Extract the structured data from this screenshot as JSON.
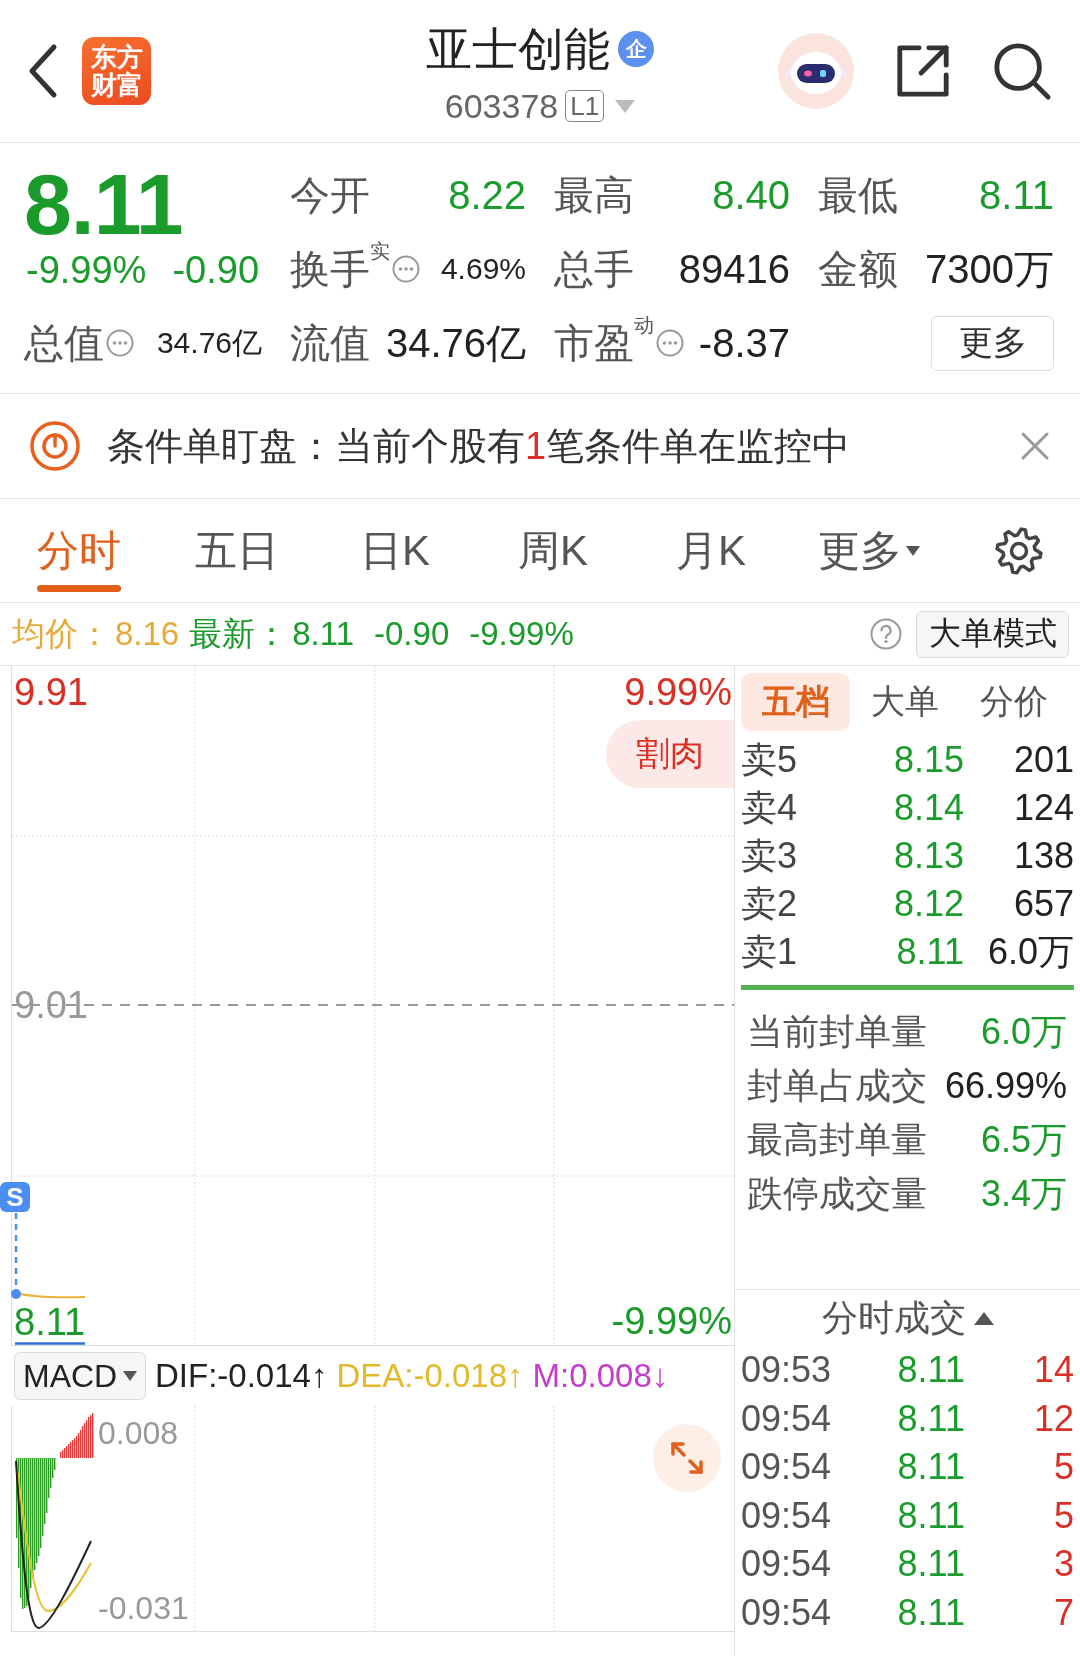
{
  "header": {
    "logo": "东方财富",
    "title": "亚士创能",
    "badge": "企",
    "code": "603378",
    "level_tag": "L1"
  },
  "quote": {
    "price": "8.11",
    "change_pct": "-9.99%",
    "change": "-0.90",
    "stats": [
      {
        "label": "今开",
        "value": "8.22",
        "color": "#1a9b2b",
        "info": false,
        "kind": "standard"
      },
      {
        "label": "最高",
        "value": "8.40",
        "color": "#1a9b2b",
        "info": false,
        "kind": "standard"
      },
      {
        "label": "最低",
        "value": "8.11",
        "color": "#1a9b2b",
        "info": false,
        "kind": "standard"
      },
      {
        "label": "换手$^{实}$",
        "value": "4.69%",
        "color": "#222222",
        "info": true,
        "kind": "compact"
      },
      {
        "label": "总手",
        "value": "89416",
        "color": "#222222",
        "info": false,
        "kind": "standard"
      },
      {
        "label": "金额",
        "value": "7300万",
        "color": "#222222",
        "info": false,
        "kind": "standard"
      },
      {
        "label": "总值",
        "value": "34.76亿",
        "color": "#222222",
        "info": true,
        "kind": "compact"
      },
      {
        "label": "流值",
        "value": "34.76亿",
        "color": "#222222",
        "info": false,
        "kind": "standard"
      },
      {
        "label": "市盈$^{动}$",
        "value": "-8.37",
        "color": "#222222",
        "info": true,
        "kind": "standard"
      }
    ],
    "more_button": "更多"
  },
  "alert": {
    "message": [
      {
        "text": "条件单盯盘：当前个股有",
        "highlight": false
      },
      {
        "text": "1",
        "highlight": true
      },
      {
        "text": "笔条件单在监控中",
        "highlight": false
      }
    ]
  },
  "period_tabs": [
    {
      "label": "分时",
      "selected": true,
      "dropdown": false
    },
    {
      "label": "五日",
      "selected": false,
      "dropdown": false
    },
    {
      "label": "日K",
      "selected": false,
      "dropdown": false
    },
    {
      "label": "周K",
      "selected": false,
      "dropdown": false
    },
    {
      "label": "月K",
      "selected": false,
      "dropdown": false
    },
    {
      "label": "更多",
      "selected": false,
      "dropdown": true
    }
  ],
  "info_bar": {
    "avg_label": "均价：",
    "avg_value": "8.16",
    "latest_label": "最新：",
    "latest_value": "8.11",
    "change": "-0.90",
    "change_pct": "-9.99%",
    "mode_button": "大单模式"
  },
  "price_chart": {
    "price_labels": [
      "9.91",
      "9.01",
      "8.11"
    ],
    "pct_labels": [
      "9.99%",
      "-9.99%"
    ],
    "tag": "割肉",
    "signal": "S"
  },
  "macd": {
    "selector": "MACD",
    "readings": [
      {
        "kind": "dif",
        "text": "DIF:-0.014↑"
      },
      {
        "kind": "dea",
        "text": "DEA:-0.018↑"
      },
      {
        "kind": "m",
        "text": "M:0.008↓"
      }
    ],
    "scale_labels": [
      "0.008",
      "-0.031"
    ]
  },
  "order_book": {
    "tabs": [
      {
        "label": "五档",
        "selected": true
      },
      {
        "label": "大单",
        "selected": false
      },
      {
        "label": "分价",
        "selected": false
      }
    ],
    "asks": [
      {
        "label": "卖5",
        "price": "8.15",
        "volume": "201"
      },
      {
        "label": "卖4",
        "price": "8.14",
        "volume": "124"
      },
      {
        "label": "卖3",
        "price": "8.13",
        "volume": "138"
      },
      {
        "label": "卖2",
        "price": "8.12",
        "volume": "657"
      },
      {
        "label": "卖1",
        "price": "8.11",
        "volume": "6.0万"
      }
    ],
    "seal_stats": [
      {
        "label": "当前封单量",
        "value": "6.0万",
        "color": "#1a9b2b"
      },
      {
        "label": "封单占成交",
        "value": "66.99%",
        "color": "#222222"
      },
      {
        "label": "最高封单量",
        "value": "6.5万",
        "color": "#1a9b2b"
      },
      {
        "label": "跌停成交量",
        "value": "3.4万",
        "color": "#1a9b2b"
      }
    ]
  },
  "trades": {
    "title": "分时成交",
    "rows": [
      {
        "time": "09:53",
        "price": "8.11",
        "volume": "14"
      },
      {
        "time": "09:54",
        "price": "8.11",
        "volume": "12"
      },
      {
        "time": "09:54",
        "price": "8.11",
        "volume": "5"
      },
      {
        "time": "09:54",
        "price": "8.11",
        "volume": "5"
      },
      {
        "time": "09:54",
        "price": "8.11",
        "volume": "3"
      },
      {
        "time": "09:54",
        "price": "8.11",
        "volume": "7"
      }
    ]
  }
}
